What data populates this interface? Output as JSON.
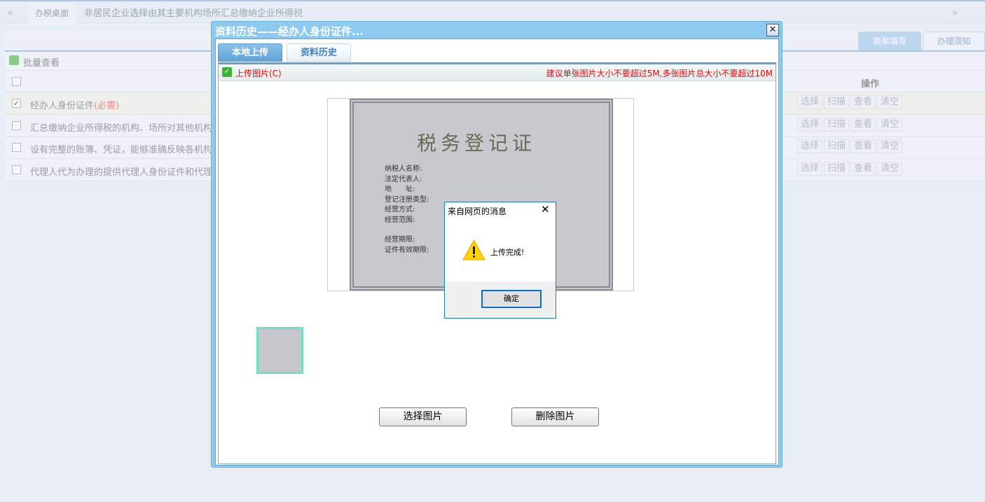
{
  "topbar": {
    "tabs": [
      "办税桌面",
      "非居民企业选择由其主要机构场所汇总缴纳企业所得税"
    ]
  },
  "right_tabs": [
    "表单填写",
    "办理须知"
  ],
  "grid": {
    "toolbar_label": "批量查看",
    "ops_header": "操作",
    "rows": [
      {
        "text": "经办人身份证件",
        "required": "(必需)",
        "checked": true
      },
      {
        "text": "汇总缴纳企业所得税的机构、场所对其他机构、场",
        "checked": false
      },
      {
        "text": "设有完整的账簿、凭证，能够准确反映各机构、场",
        "checked": false
      },
      {
        "text": "代理人代为办理的提供代理人身份证件和代理委托",
        "checked": false
      }
    ],
    "ops": [
      "选择",
      "扫描",
      "查看",
      "清空"
    ]
  },
  "modal": {
    "title": "资料历史——经办人身份证件...",
    "tabs": [
      "本地上传",
      "资料历史"
    ],
    "upload_label": "上传图片(C)",
    "hint": "建议单张图片大小不要超过5M,多张图片总大小不要超过10M",
    "image_text": {
      "heading": "税务登记证",
      "fields": [
        "纳税人名称:",
        "法定代表人:",
        "地　　址:",
        "登记注册类型:",
        "经营方式:",
        "经营范围:",
        "经营期限:",
        "证件有效期限:"
      ]
    },
    "select_button": "选择图片",
    "delete_button": "删除图片"
  },
  "alert": {
    "title": "来自网页的消息",
    "message": "上传完成!",
    "ok": "确定"
  },
  "colors": {
    "accent": "#5fa2d8",
    "hint": "#ff0000",
    "alert_border": "#1979ca"
  }
}
